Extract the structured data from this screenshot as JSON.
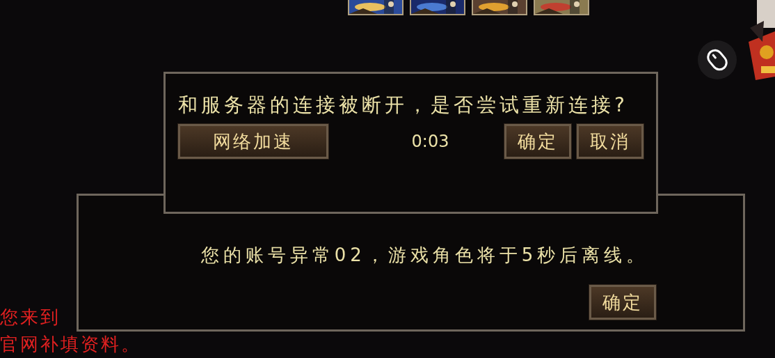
{
  "thumbnails": [
    {
      "kind": "picture"
    },
    {
      "kind": "picture"
    },
    {
      "kind": "picture"
    },
    {
      "kind": "picture"
    }
  ],
  "side_art": {
    "kind": "picture"
  },
  "dialogs": [
    {
      "message": "和服务器的连接被断开，是否尝试重新连接?",
      "left_button": "网络加速",
      "timer": "0:03",
      "buttons": [
        "确定",
        "取消"
      ]
    },
    {
      "message": "您的账号异常02，游戏角色将于5秒后离线。",
      "buttons": [
        "确定"
      ]
    }
  ],
  "chat_lines": [
    "您来到",
    "官网补填资料。"
  ]
}
